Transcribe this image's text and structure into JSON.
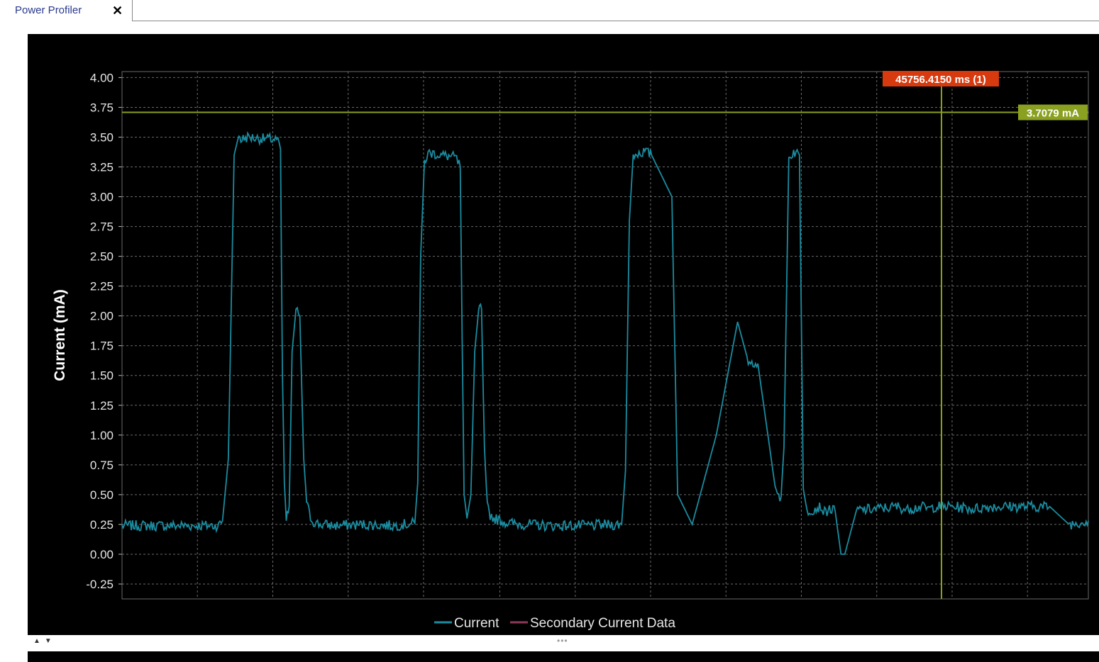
{
  "tab": {
    "label": "Power Profiler",
    "close_symbol": "✕"
  },
  "chart_data": {
    "type": "line",
    "ylabel": "Current (mA)",
    "xlabel": "",
    "ylim": [
      -0.375,
      4.05
    ],
    "yticks": [
      4.0,
      3.75,
      3.5,
      3.25,
      3.0,
      2.75,
      2.5,
      2.25,
      2.0,
      1.75,
      1.5,
      1.25,
      1.0,
      0.75,
      0.5,
      0.25,
      0.0,
      -0.25
    ],
    "ytick_labels": [
      "4.00",
      "3.75",
      "3.50",
      "3.25",
      "3.00",
      "2.75",
      "2.50",
      "2.25",
      "2.00",
      "1.75",
      "1.50",
      "1.25",
      "1.00",
      "0.75",
      "0.50",
      "0.25",
      "0.00",
      "-0.25"
    ],
    "xlim": [
      0,
      1000
    ],
    "x_gridlines": [
      0,
      78,
      156,
      234,
      312,
      391,
      469,
      547,
      625,
      703,
      781,
      859,
      937
    ],
    "grid": true,
    "legend_placement": "bottom-center",
    "series": [
      {
        "name": "Current",
        "color": "#1a8ca0",
        "x": [
          0,
          100,
          104,
          110,
          116,
          121,
          123,
          130,
          140,
          160,
          164,
          166,
          168,
          170,
          173,
          176,
          180,
          184,
          188,
          191,
          194,
          197,
          201,
          205,
          220,
          250,
          280,
          303,
          306,
          309,
          313,
          318,
          330,
          345,
          350,
          352,
          354,
          357,
          361,
          365,
          369,
          372,
          375,
          378,
          381,
          385,
          400,
          440,
          480,
          514,
          517,
          521,
          525,
          529,
          541,
          548,
          569,
          575,
          590,
          615,
          637,
          648,
          658,
          677,
          682,
          685,
          690,
          695,
          701,
          705,
          709,
          716,
          723,
          727,
          732,
          738,
          744,
          748,
          760,
          780,
          803,
          809,
          813,
          816,
          818,
          821,
          826,
          836,
          841,
          849,
          860,
          880,
          900,
          920,
          940,
          960,
          980,
          1000
        ],
        "values": [
          0.24,
          0.24,
          0.28,
          0.8,
          3.35,
          3.52,
          3.48,
          3.5,
          3.49,
          3.48,
          3.4,
          1.5,
          0.6,
          0.28,
          0.4,
          1.7,
          2.05,
          2.0,
          0.8,
          0.45,
          0.33,
          0.28,
          0.26,
          0.25,
          0.24,
          0.25,
          0.24,
          0.26,
          0.6,
          2.5,
          3.3,
          3.37,
          3.35,
          3.33,
          3.25,
          1.8,
          0.5,
          0.3,
          0.5,
          1.7,
          2.05,
          2.06,
          0.9,
          0.4,
          0.33,
          0.3,
          0.26,
          0.24,
          0.24,
          0.25,
          0.25,
          0.7,
          2.8,
          3.35,
          3.38,
          3.35,
          3.0,
          0.5,
          0.25,
          1.0,
          1.95,
          1.62,
          1.6,
          0.5,
          0.48,
          0.9,
          3.32,
          3.38,
          3.35,
          0.55,
          0.36,
          0.38,
          0.4,
          0.35,
          0.38,
          0.36,
          0.0,
          0.0,
          0.37,
          0.38,
          0.4,
          0.38,
          0.37,
          0.4,
          0.38,
          0.39,
          0.4,
          0.38,
          0.4,
          0.4,
          0.4,
          0.38,
          0.4,
          0.4,
          0.4,
          0.4,
          0.25,
          0.28
        ]
      },
      {
        "name": "Secondary Current Data",
        "color": "#8c3a5a",
        "values": []
      }
    ],
    "annotations": [
      {
        "label": "45756.4150 ms (1)",
        "x": 848,
        "color": "#d63a0e"
      },
      {
        "label": "3.7079 mA",
        "y": 3.7079,
        "color": "#8aa020"
      }
    ]
  },
  "splitter": {
    "arrows": "▲▼",
    "grip": "•••"
  }
}
